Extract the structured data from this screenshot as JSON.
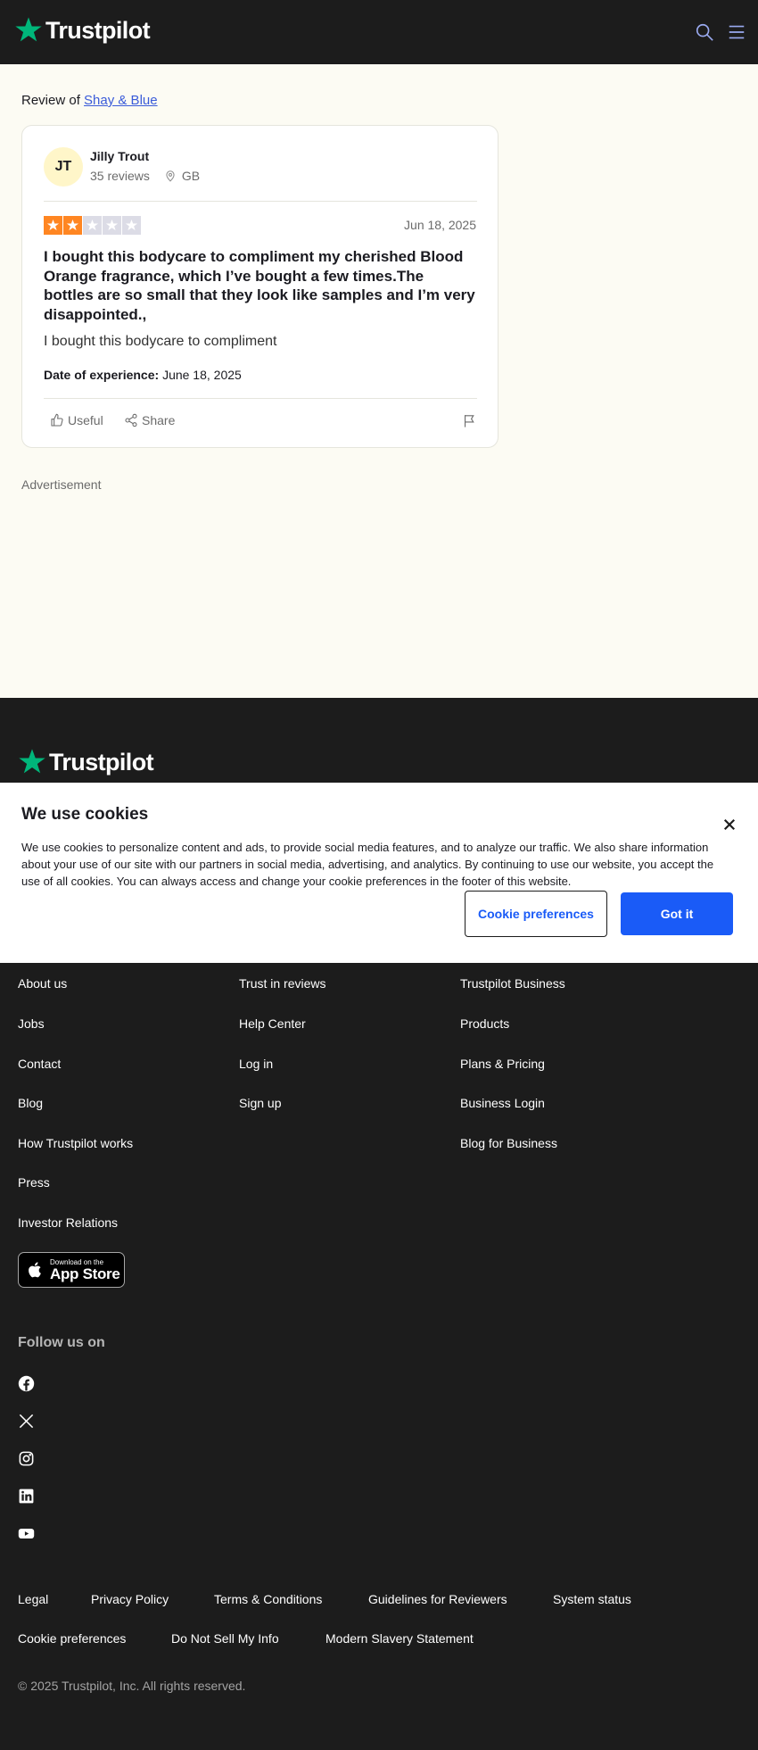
{
  "brand": {
    "name": "Trustpilot",
    "colors": {
      "green": "#00b67a",
      "dark": "#1c1c1c",
      "star_on": "#ff8622",
      "star_off": "#dcdce6",
      "link": "#3a5bd9",
      "button_blue": "#1a5bf7"
    }
  },
  "header": {
    "icons": [
      "search-icon",
      "menu-icon"
    ]
  },
  "review_page": {
    "review_of_prefix": "Review of",
    "business_name": "Shay & Blue",
    "reviewer": {
      "initials": "JT",
      "name": "Jilly Trout",
      "reviews_count": "35 reviews",
      "country": "GB"
    },
    "rating": 2,
    "rating_max": 5,
    "date": "Jun 18, 2025",
    "title": "I bought this bodycare to compliment my cherished Blood Orange fragrance, which I’ve bought a few times.The bottles are so small that they look like samples and I’m very disappointed.,",
    "body": "I bought this bodycare to compliment",
    "experience_label": "Date of experience:",
    "experience_date": "June 18, 2025",
    "actions": {
      "useful": "Useful",
      "share": "Share"
    }
  },
  "advertisement_label": "Advertisement",
  "cookie_banner": {
    "title": "We use cookies",
    "text": "We use cookies to personalize content and ads, to provide social media features, and to analyze our traffic. We also share information about your use of our site with our partners in social media, advertising, and analytics. By continuing to use our website, you accept the use of all cookies. You can always access and change your cookie preferences in the footer of this website.",
    "preferences_button": "Cookie preferences",
    "accept_button": "Got it"
  },
  "footer": {
    "columns": [
      [
        "About us",
        "Jobs",
        "Contact",
        "Blog",
        "How Trustpilot works",
        "Press",
        "Investor Relations"
      ],
      [
        "Trust in reviews",
        "Help Center",
        "Log in",
        "Sign up"
      ],
      [
        "Trustpilot Business",
        "Products",
        "Plans & Pricing",
        "Business Login",
        "Blog for Business"
      ]
    ],
    "app_store": {
      "line1": "Download on the",
      "line2": "App Store"
    },
    "follow_label": "Follow us on",
    "social": [
      "facebook-icon",
      "x-icon",
      "instagram-icon",
      "linkedin-icon",
      "youtube-icon"
    ],
    "legal_row1": [
      "Legal",
      "Privacy Policy",
      "Terms & Conditions",
      "Guidelines for Reviewers",
      "System status"
    ],
    "legal_row2": [
      "Cookie preferences",
      "Do Not Sell My Info",
      "Modern Slavery Statement"
    ],
    "copyright": "© 2025 Trustpilot, Inc. All rights reserved."
  }
}
